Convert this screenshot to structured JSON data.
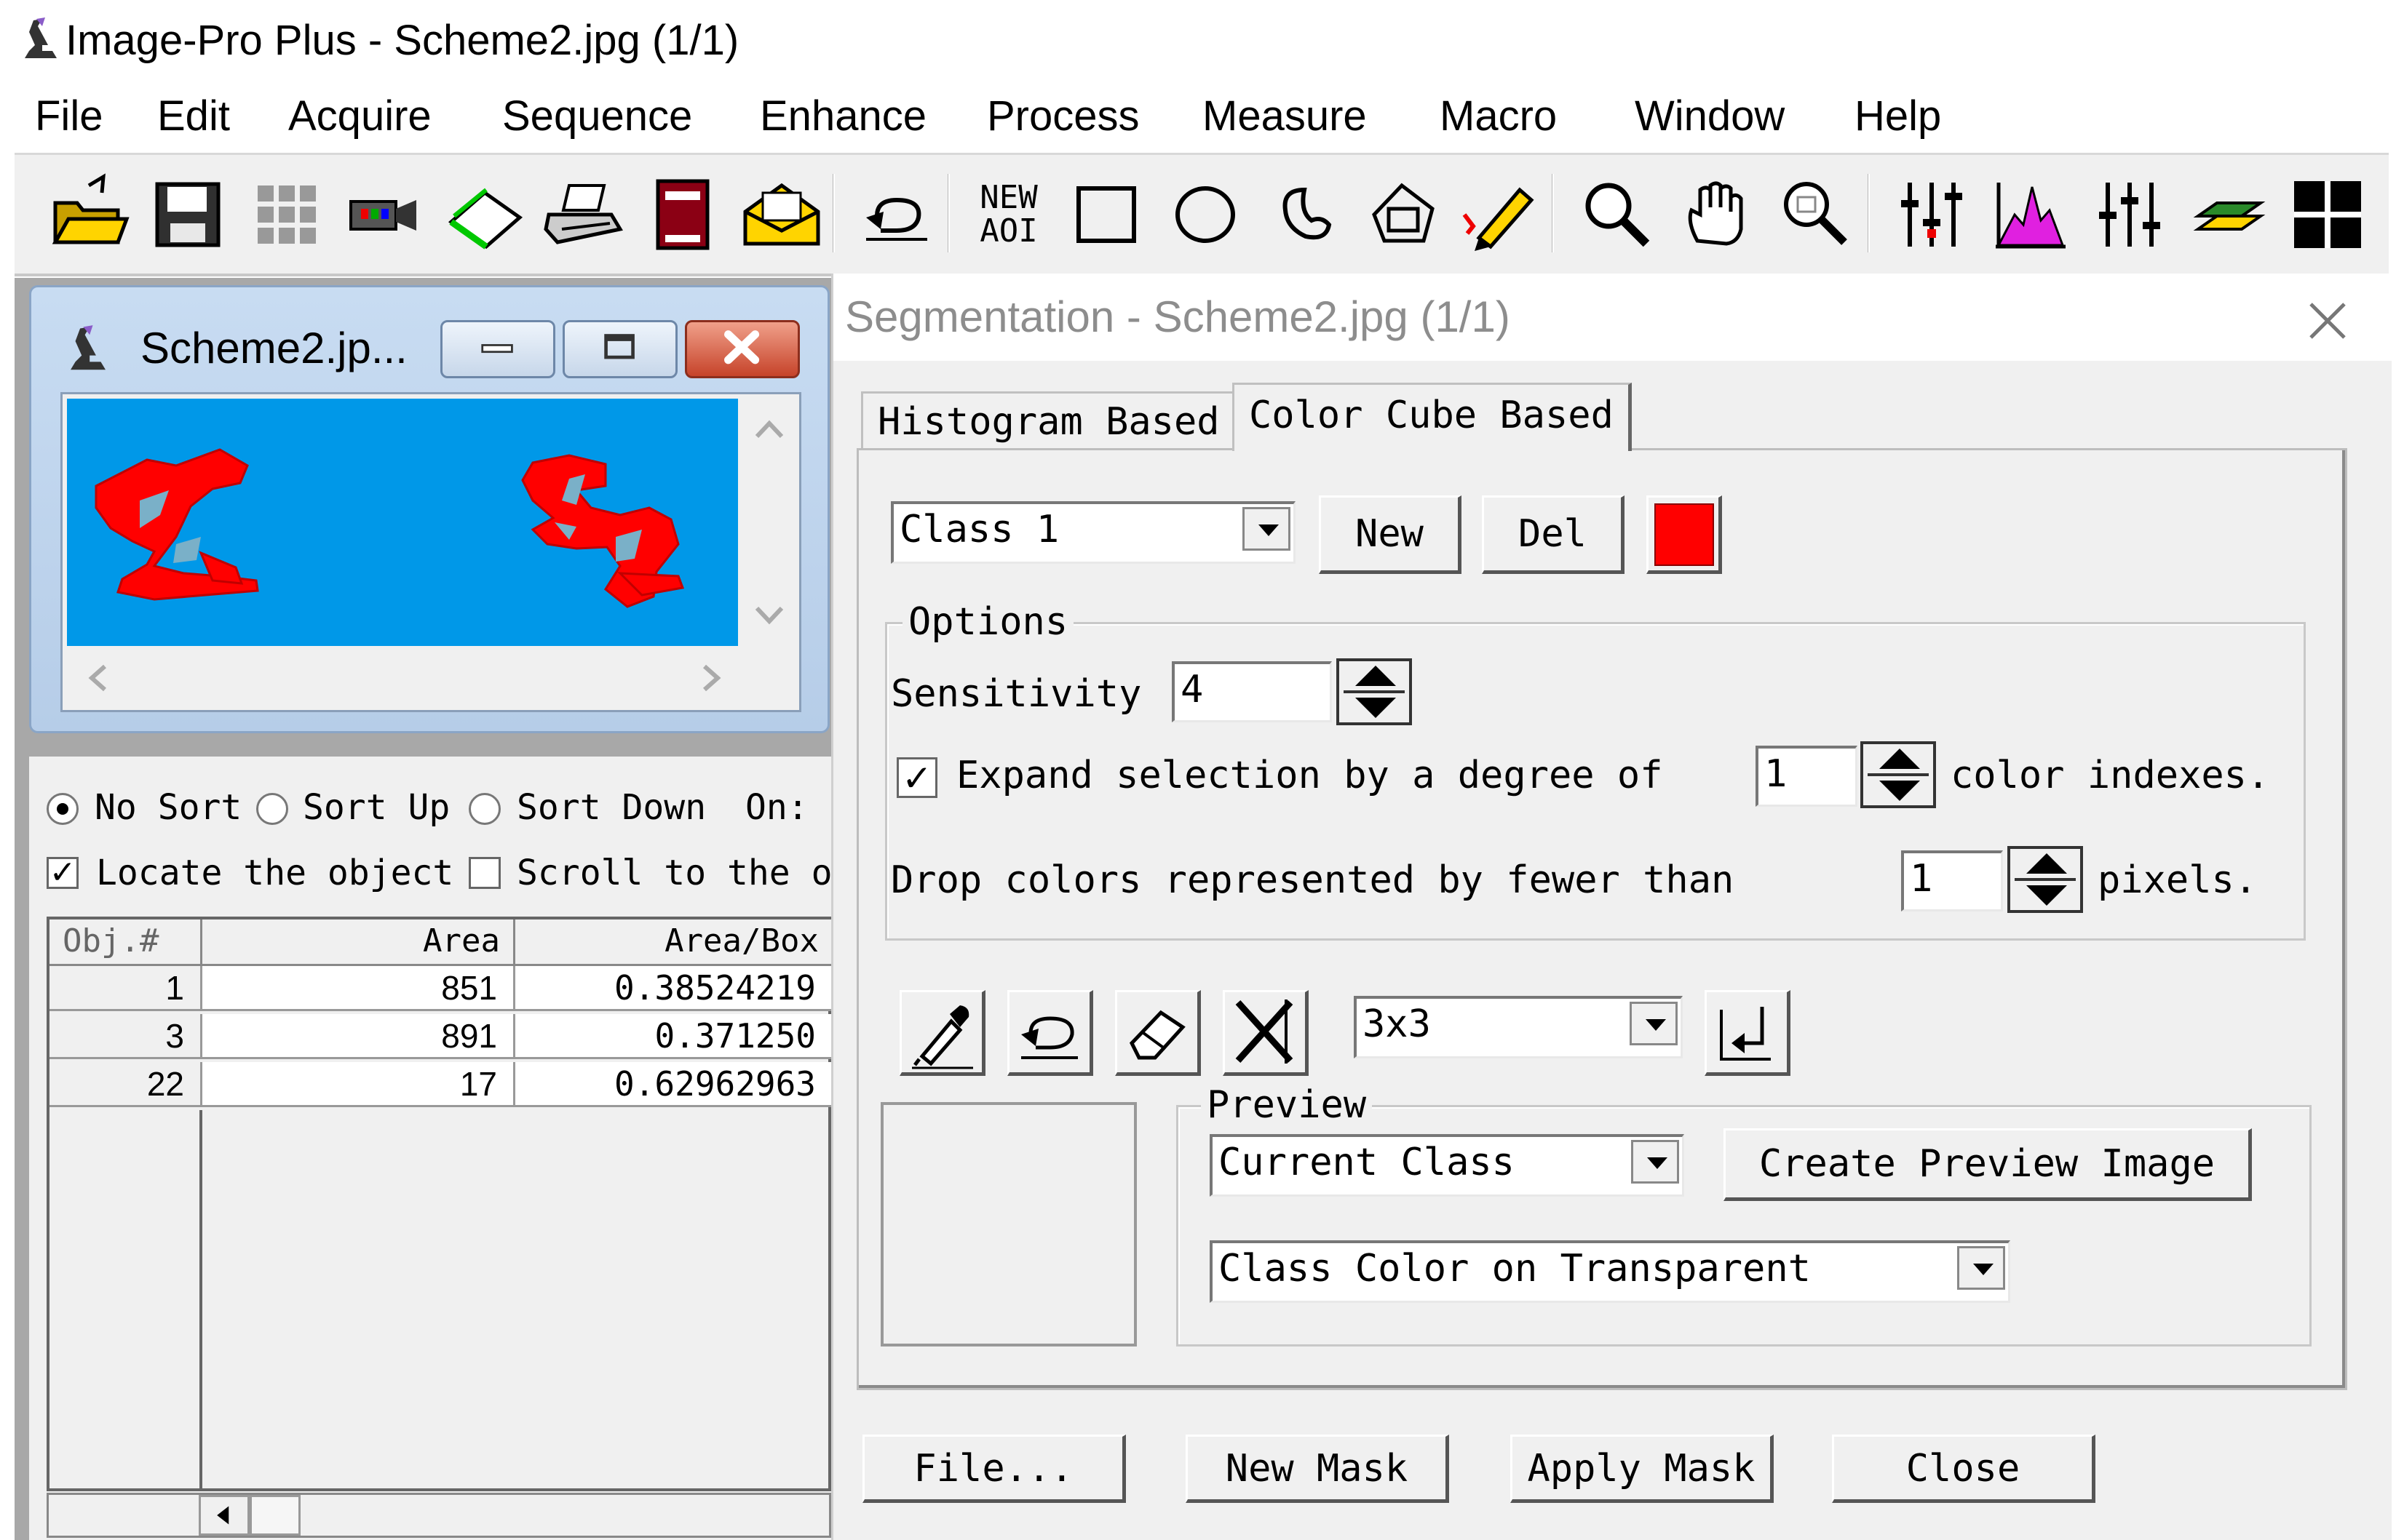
{
  "app": {
    "title": "Image-Pro Plus - Scheme2.jpg (1/1)",
    "menu": [
      "File",
      "Edit",
      "Acquire",
      "Sequence",
      "Enhance",
      "Process",
      "Measure",
      "Macro",
      "Window",
      "Help"
    ],
    "toolbar_new_aoi": [
      "NEW",
      "AOI"
    ]
  },
  "image_window": {
    "title": "Scheme2.jp..."
  },
  "objects_panel": {
    "sort_options": [
      "No Sort",
      "Sort Up",
      "Sort Down"
    ],
    "selected_sort": "No Sort",
    "on_label": "On:",
    "locate_label": "Locate the object",
    "locate_checked": true,
    "scroll_label": "Scroll to the ol",
    "scroll_checked": false,
    "columns": [
      "Obj.#",
      "Area",
      "Area/Box"
    ],
    "rows": [
      {
        "obj": "1",
        "area": "851",
        "area_box": "0.38524219"
      },
      {
        "obj": "3",
        "area": "891",
        "area_box": "0.371250"
      },
      {
        "obj": "22",
        "area": "17",
        "area_box": "0.62962963"
      }
    ]
  },
  "segmentation": {
    "title": "Segmentation - Scheme2.jpg (1/1)",
    "tabs": [
      "Histogram Based",
      "Color Cube Based"
    ],
    "active_tab": "Color Cube Based",
    "class_value": "Class 1",
    "new_label": "New",
    "del_label": "Del",
    "class_color": "#ff0000",
    "options_label": "Options",
    "sensitivity_label": "Sensitivity",
    "sensitivity_value": "4",
    "expand_label": "Expand selection by a degree of",
    "expand_checked": true,
    "expand_value": "1",
    "expand_suffix": "color indexes.",
    "drop_label": "Drop colors represented by fewer than",
    "drop_value": "1",
    "drop_suffix": "pixels.",
    "brush_size": "3x3",
    "preview_label": "Preview",
    "preview_class": "Current Class",
    "create_preview_label": "Create Preview Image",
    "preview_mode": "Class Color on Transparent",
    "buttons": {
      "file": "File...",
      "new_mask": "New Mask",
      "apply_mask": "Apply Mask",
      "close": "Close"
    }
  }
}
